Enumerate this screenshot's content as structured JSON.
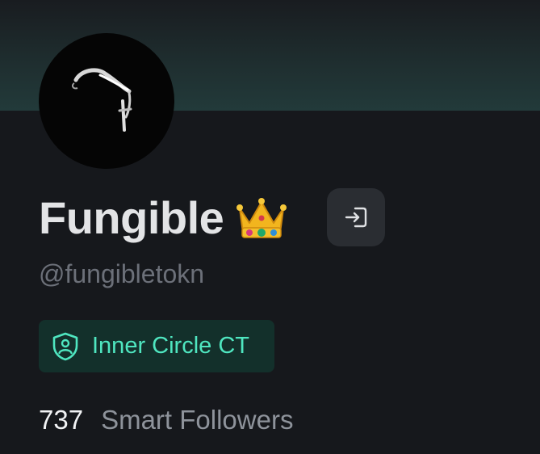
{
  "profile": {
    "display_name": "Fungible",
    "handle": "@fungibletokn",
    "name_emoji": "crown-emoji-icon"
  },
  "badge": {
    "label": "Inner Circle CT",
    "icon": "shield-person-icon",
    "accent": "#4fe6c0"
  },
  "stats": {
    "count": "737",
    "label": "Smart Followers"
  },
  "actions": {
    "login_icon": "login-icon"
  },
  "colors": {
    "background": "#16181c",
    "banner": "#223a3a",
    "text_primary": "#e3e4e6",
    "text_muted": "#6c7079"
  }
}
